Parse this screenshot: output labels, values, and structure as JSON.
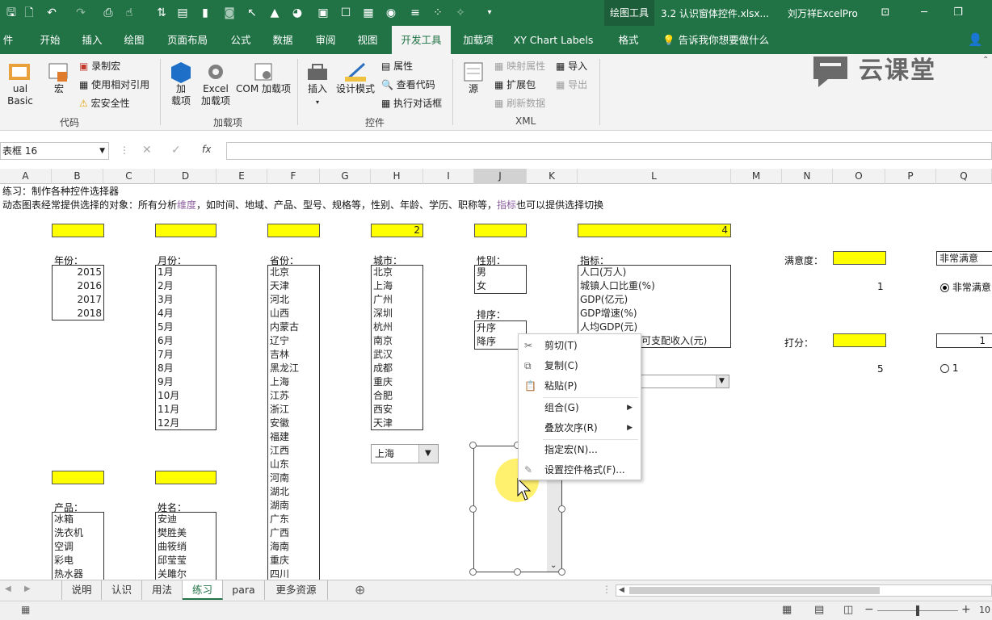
{
  "titlebar": {
    "context_tab": "绘图工具",
    "doc_title": "3.2 认识窗体控件.xlsx...",
    "user": "刘万祥ExcelPro",
    "accent": "#217346"
  },
  "tabs": [
    "件",
    "开始",
    "插入",
    "绘图",
    "页面布局",
    "公式",
    "数据",
    "审阅",
    "视图",
    "开发工具",
    "加载项",
    "XY Chart Labels",
    "格式"
  ],
  "active_tab": "开发工具",
  "tell_me": "告诉我你想要做什么",
  "ribbon": {
    "code": {
      "vb": "ual Basic",
      "macro": "宏",
      "record": "录制宏",
      "relative": "使用相对引用",
      "security": "宏安全性",
      "group": "代码"
    },
    "addins": {
      "add": "加",
      "add2": "载项",
      "excel": "Excel",
      "excel2": "加载项",
      "com": "COM 加载项",
      "group": "加载项"
    },
    "controls": {
      "insert": "插入",
      "design": "设计模式",
      "props": "属性",
      "view_code": "查看代码",
      "dialog": "执行对话框",
      "group": "控件"
    },
    "xml": {
      "source": "源",
      "map": "映射属性",
      "expand": "扩展包",
      "refresh": "刷新数据",
      "import": "导入",
      "export": "导出",
      "group": "XML"
    },
    "watermark": "云课堂"
  },
  "namebox": "表框 16",
  "fx_symbol": "fx",
  "columns": [
    "A",
    "B",
    "C",
    "D",
    "E",
    "F",
    "G",
    "H",
    "I",
    "J",
    "K",
    "L",
    "M",
    "N",
    "O",
    "P",
    "Q"
  ],
  "sheet": {
    "row1": "练习：制作各种控件选择器",
    "row2_a": "动态图表经常提供选择的对象：所有分析",
    "row2_b": "维度",
    "row2_c": "，如时间、地域、产品、型号、规格等，性别、年龄、学历、职称等，",
    "row2_d": "指标",
    "row2_e": "也可以提供选择切换",
    "city_value": "2",
    "indicator_value": "4",
    "year_label": "年份：",
    "years": [
      "2015",
      "2016",
      "2017",
      "2018"
    ],
    "month_label": "月份：",
    "months": [
      "1月",
      "2月",
      "3月",
      "4月",
      "5月",
      "6月",
      "7月",
      "8月",
      "9月",
      "10月",
      "11月",
      "12月"
    ],
    "province_label": "省份：",
    "provinces": [
      "北京",
      "天津",
      "河北",
      "山西",
      "内蒙古",
      "辽宁",
      "吉林",
      "黑龙江",
      "上海",
      "江苏",
      "浙江",
      "安徽",
      "福建",
      "江西",
      "山东",
      "河南",
      "湖北",
      "湖南",
      "广东",
      "广西",
      "海南",
      "重庆",
      "四川"
    ],
    "city_label": "城市：",
    "cities": [
      "北京",
      "上海",
      "广州",
      "深圳",
      "杭州",
      "南京",
      "武汉",
      "成都",
      "重庆",
      "合肥",
      "西安",
      "天津"
    ],
    "city_combo": "上海",
    "gender_label": "性别：",
    "genders": [
      "男",
      "女"
    ],
    "sort_label": "排序：",
    "sorts": [
      "升序",
      "降序"
    ],
    "indicator_label": "指标：",
    "indicators": [
      "人口(万人)",
      "城镇人口比重(%)",
      "GDP(亿元)",
      "GDP增速(%)",
      "人均GDP(元)",
      "可支配收入(元)"
    ],
    "satisfaction_label": "满意度：",
    "satisfaction_value": "1",
    "satisfaction_box": "非常满意",
    "satisfaction_radio": "非常满意",
    "score_label": "打分：",
    "score_value": "5",
    "score_box": "1",
    "score_radio": "1",
    "product_label": "产品：",
    "products": [
      "冰箱",
      "洗衣机",
      "空调",
      "彩电",
      "热水器"
    ],
    "name_label": "姓名：",
    "names": [
      "安迪",
      "樊胜美",
      "曲筱绡",
      "邱莹莹",
      "关雎尔"
    ]
  },
  "context_menu": {
    "cut": "剪切(T)",
    "copy": "复制(C)",
    "paste": "粘贴(P)",
    "group": "组合(G)",
    "order": "叠放次序(R)",
    "assign": "指定宏(N)...",
    "format": "设置控件格式(F)..."
  },
  "sheet_tabs": [
    "说明",
    "认识",
    "用法",
    "练习",
    "para",
    "更多资源"
  ],
  "active_sheet": "练习",
  "status": {
    "zoom": "10"
  }
}
